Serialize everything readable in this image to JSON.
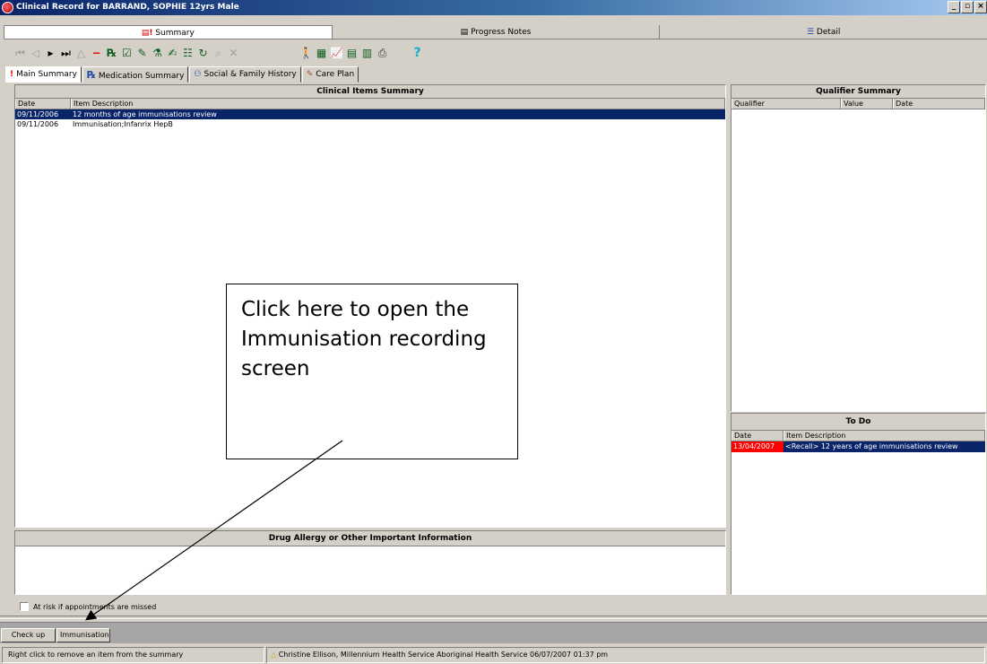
{
  "window": {
    "title": "Clinical Record for BARRAND, SOPHIE 12yrs Male",
    "controls": [
      "_",
      "▫",
      "×"
    ]
  },
  "top_tabs": [
    {
      "label": "Summary",
      "icon": "summary-icon"
    },
    {
      "label": "Progress Notes",
      "icon": "notes-icon"
    },
    {
      "label": "Detail",
      "icon": "list-icon"
    }
  ],
  "sub_tabs": [
    {
      "label": "Main Summary",
      "icon": "!"
    },
    {
      "label": "Medication Summary",
      "icon": "Rx"
    },
    {
      "label": "Social & Family History",
      "icon": "family-icon"
    },
    {
      "label": "Care Plan",
      "icon": "pencil-icon"
    }
  ],
  "clinical": {
    "title": "Clinical Items Summary",
    "columns": [
      "Date",
      "Item Description"
    ],
    "rows": [
      {
        "date": "09/11/2006",
        "desc": "12 months of age immunisations review"
      },
      {
        "date": "09/11/2006",
        "desc": "Immunisation;Infanrix HepB"
      }
    ]
  },
  "drug": {
    "title": "Drug Allergy or Other Important Information"
  },
  "qualifier": {
    "title": "Qualifier Summary",
    "columns": [
      "Qualifier",
      "Value",
      "Date"
    ]
  },
  "todo": {
    "title": "To Do",
    "columns": [
      "Date",
      "Item Description"
    ],
    "rows": [
      {
        "date": "13/04/2007",
        "desc": "<Recall> 12 years of age immunisations review",
        "overdue_color": "#ff0000"
      }
    ]
  },
  "at_risk_label": "At risk if appointments are missed",
  "buttons": {
    "checkup": "Check up",
    "immunisation": "Immunisation"
  },
  "status": {
    "hint": "Right click to remove an item from the summary",
    "user": "Christine Ellison, Millennium Health Service Aboriginal Health Service 06/07/2007 01:37 pm"
  },
  "callout": {
    "text": "Click here to open the Immunisation recording screen"
  }
}
